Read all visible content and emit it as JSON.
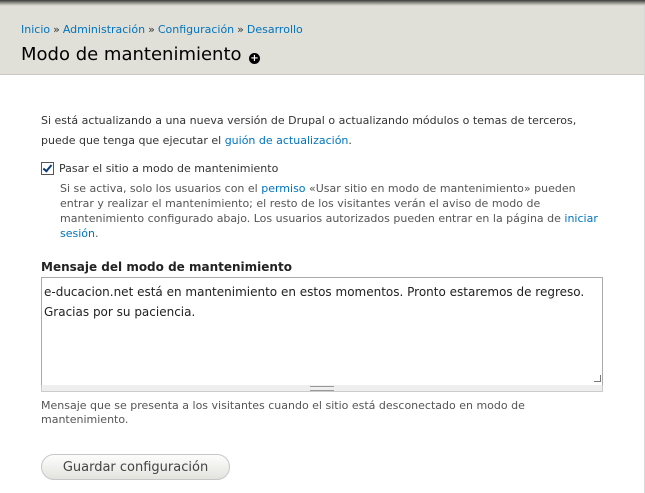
{
  "breadcrumb": {
    "items": [
      "Inicio",
      "Administración",
      "Configuración",
      "Desarrollo"
    ],
    "separator": "»"
  },
  "header": {
    "title": "Modo de mantenimiento",
    "shortcut_glyph": "+"
  },
  "intro": {
    "text_before": "Si está actualizando a una nueva versión de Drupal o actualizando módulos o temas de terceros, puede que tenga que ejecutar el ",
    "link": "guión de actualización",
    "text_after": "."
  },
  "maintenance_checkbox": {
    "label": "Pasar el sitio a modo de mantenimiento",
    "checked": true,
    "desc_before": "Si se activa, solo los usuarios con el ",
    "desc_link_permiso": "permiso",
    "desc_middle": " «Usar sitio en modo de mantenimiento» pueden entrar y realizar el mantenimiento; el resto de los visitantes verán el aviso de modo de mantenimiento configurado abajo. Los usuarios autorizados pueden entrar en la página de ",
    "desc_link_login": "iniciar sesión",
    "desc_after": "."
  },
  "message_field": {
    "label": "Mensaje del modo de mantenimiento",
    "value": "e-ducacion.net está en mantenimiento en estos momentos. Pronto estaremos de regreso. Gracias por su paciencia.",
    "description": "Mensaje que se presenta a los visitantes cuando el sitio está desconectado en modo de mantenimiento."
  },
  "actions": {
    "save_label": "Guardar configuración"
  }
}
